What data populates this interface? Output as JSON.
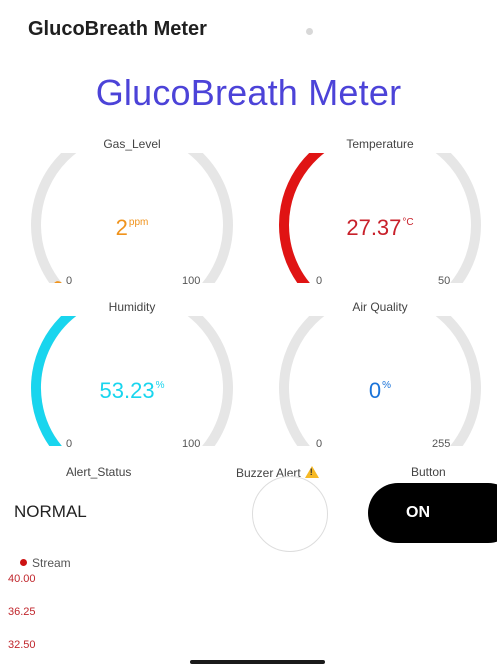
{
  "header": {
    "title": "GlucoBreath Meter"
  },
  "page_title": "GlucoBreath Meter",
  "gauges": [
    {
      "title": "Gas_Level",
      "value": "2",
      "unit": "ppm",
      "min": "0",
      "max": "100",
      "numeric_value": 2,
      "range": [
        0,
        100
      ],
      "color": "#f0931c"
    },
    {
      "title": "Temperature",
      "value": "27.37",
      "unit": "°C",
      "min": "0",
      "max": "50",
      "numeric_value": 27.37,
      "range": [
        0,
        50
      ],
      "color": "#e01414"
    },
    {
      "title": "Humidity",
      "value": "53.23",
      "unit": "%",
      "min": "0",
      "max": "100",
      "numeric_value": 53.23,
      "range": [
        0,
        100
      ],
      "color": "#19d5ee"
    },
    {
      "title": "Air Quality",
      "value": "0",
      "unit": "%",
      "min": "0",
      "max": "255",
      "numeric_value": 0,
      "range": [
        0,
        255
      ],
      "color": "#1a73d9"
    }
  ],
  "widgets": {
    "alert_status_label": "Alert_Status",
    "alert_status_value": "NORMAL",
    "buzzer_label": "Buzzer Alert",
    "button_label": "Button",
    "button_value": "ON"
  },
  "chart": {
    "legend": "Stream",
    "y_ticks": [
      "40.00",
      "36.25",
      "32.50"
    ],
    "series_color": "#cc1212"
  },
  "colors": {
    "title": "#4c43d8",
    "track": "#e6e6e6"
  }
}
